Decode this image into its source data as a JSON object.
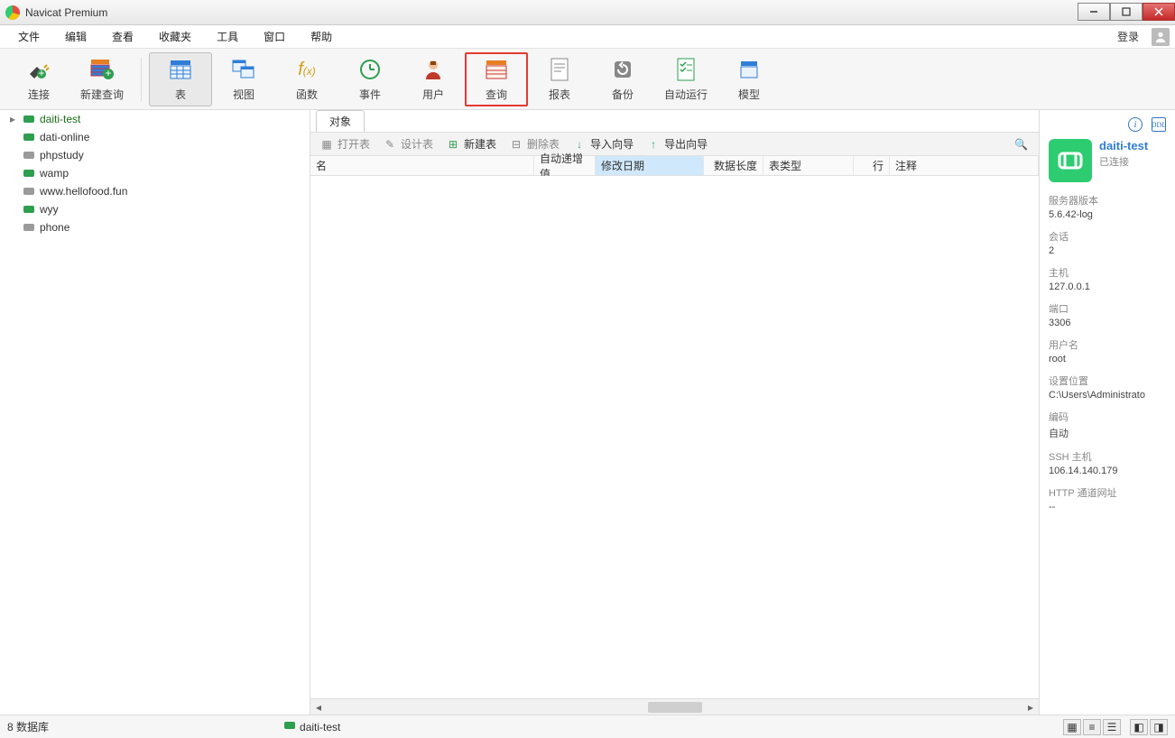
{
  "app": {
    "title": "Navicat Premium"
  },
  "menu": {
    "items": [
      "文件",
      "编辑",
      "查看",
      "收藏夹",
      "工具",
      "窗口",
      "帮助"
    ],
    "login": "登录"
  },
  "toolbar": {
    "connect": "连接",
    "newquery": "新建查询",
    "table": "表",
    "view": "视图",
    "function": "函数",
    "event": "事件",
    "user": "用户",
    "query": "查询",
    "report": "报表",
    "backup": "备份",
    "autorun": "自动运行",
    "model": "模型"
  },
  "connections": [
    {
      "name": "daiti-test",
      "active": true
    },
    {
      "name": "dati-online",
      "active": false
    },
    {
      "name": "phpstudy",
      "active": false,
      "gray": true
    },
    {
      "name": "wamp",
      "active": false
    },
    {
      "name": "www.hellofood.fun",
      "active": false,
      "gray": true
    },
    {
      "name": "wyy",
      "active": false
    },
    {
      "name": "phone",
      "active": false,
      "gray": true
    }
  ],
  "tabs": {
    "object": "对象"
  },
  "subtoolbar": {
    "open": "打开表",
    "design": "设计表",
    "new": "新建表",
    "delete": "删除表",
    "import": "导入向导",
    "export": "导出向导"
  },
  "columns": {
    "name": "名",
    "autoinc": "自动递增值",
    "modified": "修改日期",
    "datalen": "数据长度",
    "tabletype": "表类型",
    "rows": "行",
    "comment": "注释"
  },
  "info": {
    "name": "daiti-test",
    "status": "已连接",
    "kv": [
      {
        "k": "服务器版本",
        "v": "5.6.42-log"
      },
      {
        "k": "会话",
        "v": "2"
      },
      {
        "k": "主机",
        "v": "127.0.0.1"
      },
      {
        "k": "端口",
        "v": "3306"
      },
      {
        "k": "用户名",
        "v": "root"
      },
      {
        "k": "设置位置",
        "v": "C:\\Users\\Administrato"
      },
      {
        "k": "编码",
        "v": "自动"
      },
      {
        "k": "SSH 主机",
        "v": "106.14.140.179"
      },
      {
        "k": "HTTP 通道网址",
        "v": "--"
      }
    ]
  },
  "status": {
    "left": "8 数据库",
    "conn": "daiti-test"
  }
}
